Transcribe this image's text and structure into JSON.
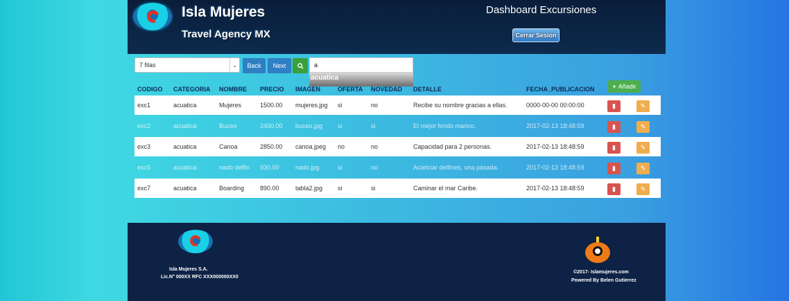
{
  "header": {
    "brand_title": "Isla Mujeres",
    "brand_subtitle": "Travel Agency MX",
    "dashboard_title": "Dashboard Excursiones",
    "logout_label": "Cerrar Sesion"
  },
  "toolbar": {
    "rows_selected": "7 filas",
    "back_label": "Back",
    "next_label": "Next",
    "search_icon": "search-icon",
    "search_value": "a",
    "suggestion": "acuatica",
    "add_label": "Añadir"
  },
  "table": {
    "columns": [
      "CODIGO",
      "CATEGORIA",
      "NOMBRE",
      "PRECIO",
      "IMAGEN",
      "OFERTA",
      "NOVEDAD",
      "DETALLE",
      "FECHA_PUBLICACION"
    ],
    "rows": [
      {
        "codigo": "exc1",
        "categoria": "acuatica",
        "nombre": "Mujeres",
        "precio": "1500.00",
        "imagen": "mujeres.jpg",
        "oferta": "si",
        "novedad": "no",
        "detalle": "Recibe su nombre gracias a ellas.",
        "fecha": "0000-00-00 00:00:00"
      },
      {
        "codigo": "exc2",
        "categoria": "acuatica",
        "nombre": "Buceo",
        "precio": "2400.00",
        "imagen": "buceo.jpg",
        "oferta": "si",
        "novedad": "si",
        "detalle": "El mejor fondo marino.",
        "fecha": "2017-02-13 18:48:59"
      },
      {
        "codigo": "exc3",
        "categoria": "acuatica",
        "nombre": "Canoa",
        "precio": "2850.00",
        "imagen": "canoa.jpeg",
        "oferta": "no",
        "novedad": "no",
        "detalle": "Capacidad para 2 personas.",
        "fecha": "2017-02-13 18:48:59"
      },
      {
        "codigo": "exc5",
        "categoria": "acuatica",
        "nombre": "nado delfin",
        "precio": "930.00",
        "imagen": "nado.jpg",
        "oferta": "si",
        "novedad": "no",
        "detalle": "Acariciar delfines, una pasada.",
        "fecha": "2017-02-13 18:48:59"
      },
      {
        "codigo": "exc7",
        "categoria": "acuatica",
        "nombre": "Boarding",
        "precio": "890.00",
        "imagen": "tabla2.jpg",
        "oferta": "si",
        "novedad": "si",
        "detalle": "Caminar el mar Caribe.",
        "fecha": "2017-02-13 18:48:59"
      }
    ]
  },
  "footer": {
    "company": "Isla Mujeres S.A.",
    "license": "Lic.N° 000XX RFC XXX000000XX0",
    "copyright": "©2017- Islamujeres.com",
    "powered": "Powered By Belen Gutierrez"
  }
}
